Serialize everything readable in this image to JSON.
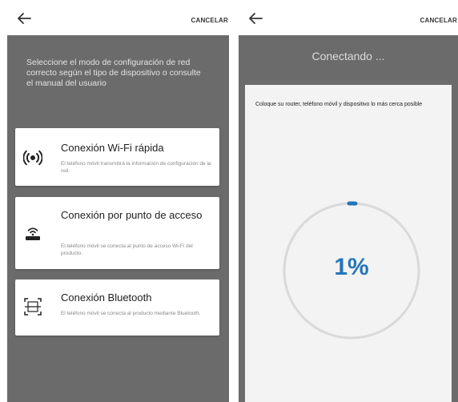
{
  "left_screen": {
    "header": {
      "back_icon": "arrow-left-icon",
      "cancel_label": "CANCELAR"
    },
    "instruction": "Seleccione el modo de configuración de red correcto según el tipo de dispositivo o consulte el manual del usuario",
    "options": [
      {
        "icon": "wifi-fast-icon",
        "title": "Conexión Wi-Fi rápida",
        "description": "El teléfono móvil transmitirá la información de configuración de la red."
      },
      {
        "icon": "access-point-icon",
        "title": "Conexión por punto de acceso",
        "description": "El teléfono móvil se conecta al punto de acceso Wi-Fi del producto."
      },
      {
        "icon": "bluetooth-scan-icon",
        "title": "Conexión Bluetooth",
        "description": "El teléfono móvil se conecta al producto mediante Bluetooth."
      }
    ]
  },
  "right_screen": {
    "header": {
      "back_icon": "arrow-left-icon",
      "cancel_label": "CANCELAR"
    },
    "title": "Conectando ...",
    "hint": "Coloque su router, teléfono móvil y dispositivo lo más cerca posible",
    "progress": {
      "percent": 1,
      "label": "1%"
    }
  },
  "colors": {
    "overlay": "#6b6b6b",
    "accent": "#2576b8",
    "ring": "#d9d9d9"
  }
}
